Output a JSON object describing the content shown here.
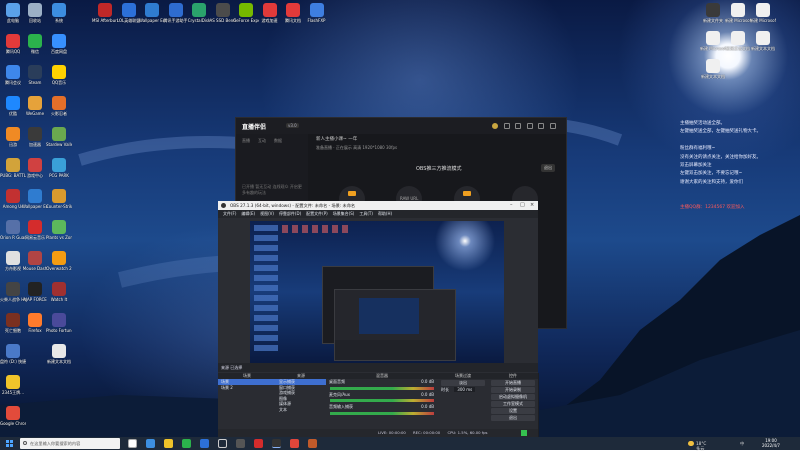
{
  "desktop": {
    "icons_col1": [
      {
        "label": "此电脑",
        "color": "#5aa0e8"
      },
      {
        "label": "腾讯QQ",
        "color": "#e23a3a"
      },
      {
        "label": "腾讯会议",
        "color": "#3e87ea"
      },
      {
        "label": "优酷",
        "color": "#1e88ff"
      },
      {
        "label": "迅游",
        "color": "#f08a24"
      },
      {
        "label": "PUBG: BATTLEGR...",
        "color": "#d2a33a"
      },
      {
        "label": "Among Us",
        "color": "#c23131"
      },
      {
        "label": "Orion R Guard",
        "color": "#5670a8"
      },
      {
        "label": "方舟影视",
        "color": "#e0e0e0"
      },
      {
        "label": "火柴人战争 Ho...",
        "color": "#444"
      },
      {
        "label": "死亡细胞",
        "color": "#7a3020"
      },
      {
        "label": "盘符 (D:) 快捷方式",
        "color": "#4a79c8"
      },
      {
        "label": "2345王牌...",
        "color": "#f0c42a"
      },
      {
        "label": "Google Chrome",
        "color": "#e24b3b"
      }
    ],
    "icons_col2": [
      {
        "label": "回收站",
        "color": "#9cb0c6"
      },
      {
        "label": "微信",
        "color": "#2bb24c"
      },
      {
        "label": "Steam",
        "color": "#2a3d5a"
      },
      {
        "label": "WeGame",
        "color": "#e6a23a"
      },
      {
        "label": "加速器",
        "color": "#3a3a3a"
      },
      {
        "label": "游戏中心",
        "color": "#d04141"
      },
      {
        "label": "Wallpaper Engine",
        "color": "#2f7cd0"
      },
      {
        "label": "网易云音乐",
        "color": "#d42c2c"
      },
      {
        "label": "Mouse Dash",
        "color": "#b04444"
      },
      {
        "label": "AJAP FORCE",
        "color": "#222"
      },
      {
        "label": "Firefox",
        "color": "#ff7b2c"
      }
    ],
    "icons_col3": [
      {
        "label": "系统",
        "color": "#3c8de0"
      },
      {
        "label": "百度网盘",
        "color": "#3790ff"
      },
      {
        "label": "QQ音乐",
        "color": "#ffd200"
      },
      {
        "label": "火影忍者",
        "color": "#e36f2a"
      },
      {
        "label": "Stardew Valley",
        "color": "#6aa84f"
      },
      {
        "label": "PCG PARK",
        "color": "#3aa0d8"
      },
      {
        "label": "Counter-Strike 2 Global Off",
        "color": "#d99a2e"
      },
      {
        "label": "Plants vs Zombies",
        "color": "#5cb85c"
      },
      {
        "label": "Overwatch 2",
        "color": "#f39c12"
      },
      {
        "label": "Watch It",
        "color": "#a03030"
      },
      {
        "label": "Photo Fortune ...",
        "color": "#4a4a9a"
      },
      {
        "label": "新建文本文档",
        "color": "#e8e8e8"
      }
    ],
    "icons_top_row": [
      {
        "label": "MSI Afterburner",
        "color": "#c02828"
      },
      {
        "label": "LOL英雄联盟",
        "color": "#2c70d8"
      },
      {
        "label": "Wallpaper Engine",
        "color": "#2f7cd0"
      },
      {
        "label": "腾讯手游助手",
        "color": "#2e6cd0"
      },
      {
        "label": "CrystalDisk",
        "color": "#2aa36c"
      },
      {
        "label": "AS SSD Benchmark",
        "color": "#4b4b4b"
      },
      {
        "label": "GeForce Experience",
        "color": "#76b900"
      },
      {
        "label": "游戏加速",
        "color": "#e03a3a"
      },
      {
        "label": "腾讯文档",
        "color": "#e23a3a"
      },
      {
        "label": "FlashFXP",
        "color": "#3e7ee0"
      }
    ],
    "icons_right": [
      {
        "label": "新建文件夹",
        "color": "#3a3a3a"
      },
      {
        "label": "新建 Microsoft Word 文档",
        "color": "#f0f0f0"
      },
      {
        "label": "新建 Microsoft Word 文档",
        "color": "#f0f0f0"
      },
      {
        "label": "新建 Microsoft Word 文档",
        "color": "#f0f0f0"
      },
      {
        "label": "新建文本文档",
        "color": "#f0f0f0"
      },
      {
        "label": "新建文本文档",
        "color": "#f0f0f0"
      },
      {
        "label": "新建文本文档",
        "color": "#f0f0f0"
      }
    ],
    "notes": [
      {
        "text": "主播抽奖活动送全部。",
        "color": "normal"
      },
      {
        "text": "左键抽奖送全部，左键抽奖送礼物大卡。",
        "color": "normal"
      },
      {
        "text": "",
        "color": "normal"
      },
      {
        "text": "粉丝群有福利哦~",
        "color": "normal"
      },
      {
        "text": "没有关注的请点关注，关注给你加好友。",
        "color": "normal"
      },
      {
        "text": "双击屏幕加关注",
        "color": "normal"
      },
      {
        "text": "左键双击加关注，不要忘记哦~",
        "color": "normal"
      },
      {
        "text": "谢谢大家的关注和支持，爱你们",
        "color": "normal"
      },
      {
        "text": "",
        "color": "normal"
      },
      {
        "text": "",
        "color": "normal"
      },
      {
        "text": "主播QQ群：1234567 欢迎加入",
        "color": "red"
      }
    ]
  },
  "live_app": {
    "logo": "直播伴侣",
    "version": "v3.0",
    "side_tabs": [
      "直播",
      "互动",
      "数据"
    ],
    "side_hint": "已开播 暂无互动 连线观众 开启更多有趣的玩法",
    "room_title": "新人主播小课~ 一年",
    "room_bar": "准备直播 · 正在展示   高清  1920*1080  30fps",
    "mode": "OBS推三方推流模式",
    "mode_btn": "退出",
    "circle_labels": [
      "推流",
      "RAW URL",
      "",
      "",
      ""
    ]
  },
  "obs": {
    "title": "OBS 27.1.3 (64-bit, windows) - 配置文件: 未命名 - 场景: 未命名",
    "menu": [
      "文件(F)",
      "编辑(E)",
      "视图(V)",
      "停靠部件(D)",
      "配置文件(P)",
      "场景集合(S)",
      "工具(T)",
      "帮助(H)"
    ],
    "bottom_header": "来源 已选择",
    "scenes": {
      "title": "场景",
      "items": [
        "场景",
        "场景 2"
      ]
    },
    "sources": {
      "title": "来源",
      "items": [
        "显示捕获",
        "窗口捕获",
        "游戏捕获",
        "图像",
        "媒体源",
        "文本"
      ]
    },
    "mixer": {
      "title": "混音器",
      "channels": [
        "桌面音频",
        "麦克风/Aux",
        "音频输入捕获"
      ],
      "levels": [
        "0.0 dB",
        "0.0 dB",
        "0.0 dB"
      ]
    },
    "transitions": {
      "title": "场景过渡",
      "type": "淡出",
      "duration_label": "时长",
      "duration": "300 ms"
    },
    "controls": {
      "title": "控件",
      "buttons": [
        "开始直播",
        "开始录制",
        "启动虚拟摄像机",
        "工作室模式",
        "设置",
        "退出"
      ]
    },
    "status": {
      "live": "LIVE: 00:00:00",
      "rec": "REC: 00:00:00",
      "cpu": "CPU: 1.5%, 60.00 fps",
      "drop": "丢帧 0 (0.0%)"
    }
  },
  "taskbar": {
    "search_placeholder": "在这里输入你要搜索的内容",
    "weather": "18°C 多云",
    "lang": "中",
    "time": "19:00",
    "date": "2022/4/7"
  }
}
